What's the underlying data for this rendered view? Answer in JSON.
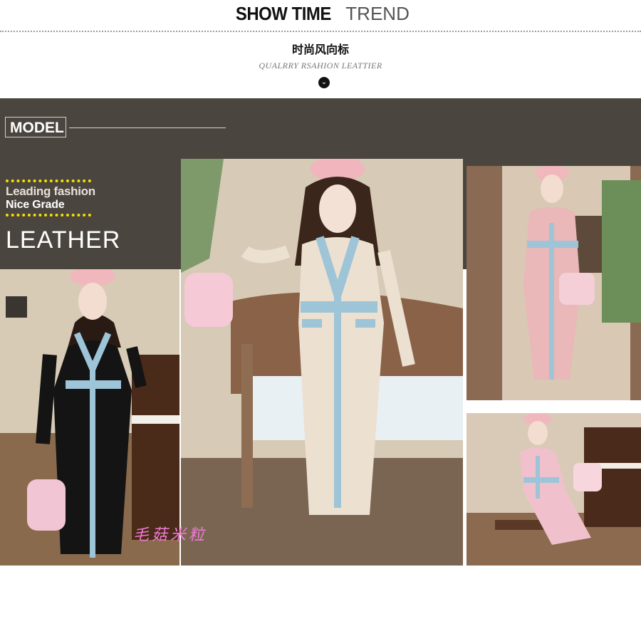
{
  "header": {
    "title_bold": "SHOW TIME",
    "title_light": "TREND",
    "subtitle_cn": "时尚风向标",
    "subtitle_en": "QUALRRY RSAHION LEATTIER",
    "arrow_icon": "chevron-down-circle-icon"
  },
  "band": {
    "model_label": "MODEL",
    "tagline_1": "Leading fashion",
    "tagline_2": "Nice Grade",
    "category": "LEATHER"
  },
  "photos": {
    "watermark": "毛菇米粒"
  },
  "colors": {
    "band_bg": "#4b4540",
    "accent_dots": "#f5e000",
    "trim_blue": "#9ec4d8",
    "watermark": "#f07ad6"
  }
}
